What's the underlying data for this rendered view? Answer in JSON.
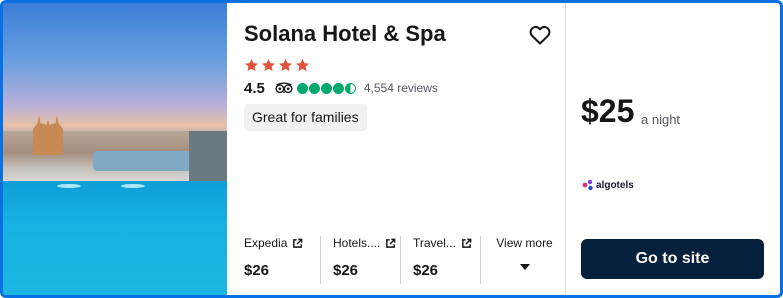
{
  "hotel": {
    "name": "Solana Hotel & Spa",
    "star_count": 4,
    "rating": "4.5",
    "review_bubbles": 4.5,
    "reviews": "4,554 reviews",
    "tag": "Great for families"
  },
  "providers": [
    {
      "name": "Expedia",
      "price": "$26"
    },
    {
      "name": "Hotels....",
      "price": "$26"
    },
    {
      "name": "Travel...",
      "price": "$26"
    }
  ],
  "view_more_label": "View more",
  "offer": {
    "price": "$25",
    "period": "a night",
    "partner": "algotels",
    "button_label": "Go to site"
  },
  "colors": {
    "card_border": "#0770e3",
    "star": "#e1523d",
    "bubble": "#00aa6c",
    "button_bg": "#05203c"
  }
}
